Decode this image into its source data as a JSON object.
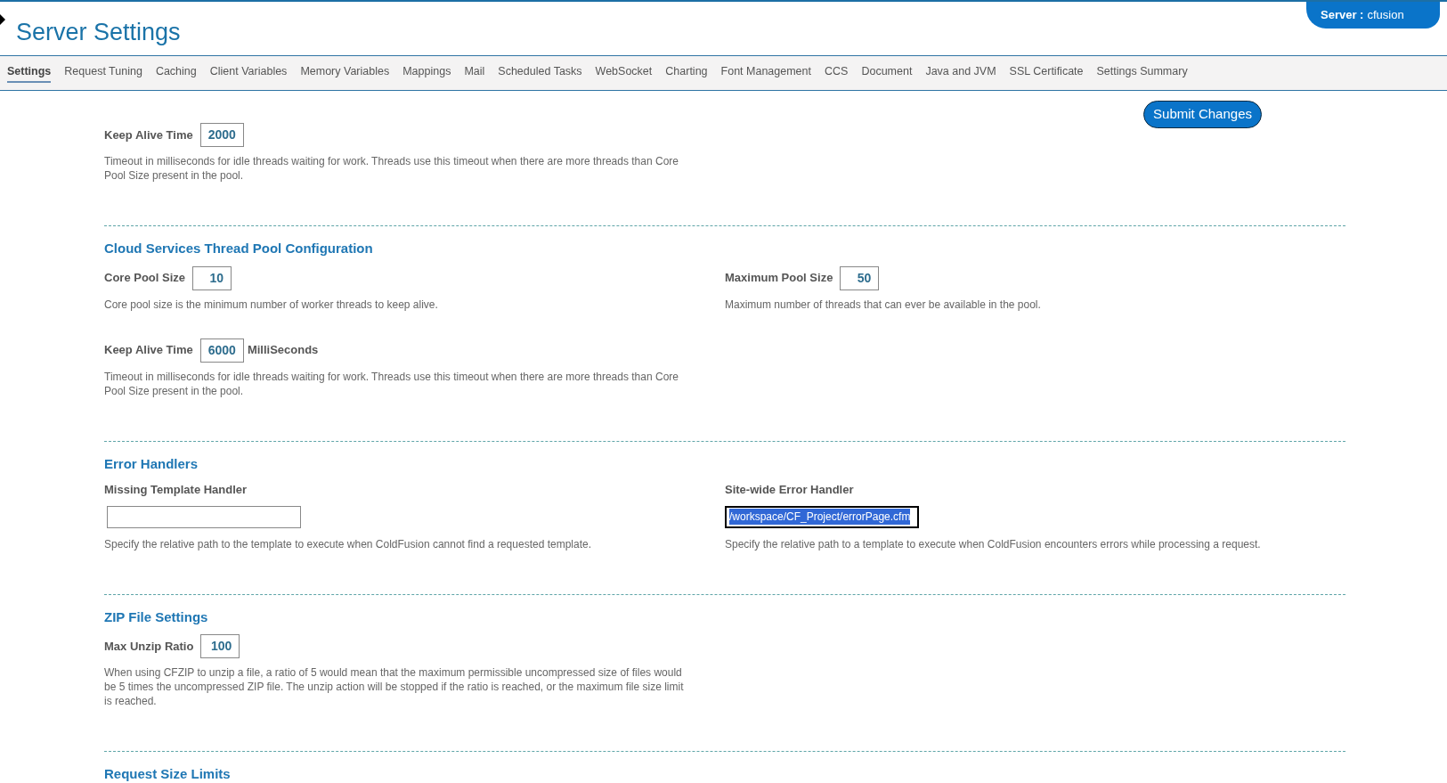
{
  "header": {
    "title": "Server Settings",
    "server_label": "Server :",
    "server_name": "cfusion"
  },
  "tabs": [
    {
      "label": "Settings",
      "selected": true
    },
    {
      "label": "Request Tuning",
      "selected": false
    },
    {
      "label": "Caching",
      "selected": false
    },
    {
      "label": "Client Variables",
      "selected": false
    },
    {
      "label": "Memory Variables",
      "selected": false
    },
    {
      "label": "Mappings",
      "selected": false
    },
    {
      "label": "Mail",
      "selected": false
    },
    {
      "label": "Scheduled Tasks",
      "selected": false
    },
    {
      "label": "WebSocket",
      "selected": false
    },
    {
      "label": "Charting",
      "selected": false
    },
    {
      "label": "Font Management",
      "selected": false
    },
    {
      "label": "CCS",
      "selected": false
    },
    {
      "label": "Document",
      "selected": false
    },
    {
      "label": "Java and JVM",
      "selected": false
    },
    {
      "label": "SSL Certificate",
      "selected": false
    },
    {
      "label": "Settings Summary",
      "selected": false
    }
  ],
  "submit_button": "Submit Changes",
  "sections": [
    {
      "rows": [
        [
          {
            "kind": "inline",
            "label": "Keep Alive Time",
            "value": "2000",
            "description": "Timeout in milliseconds for idle threads waiting for work. Threads use this timeout when there are more threads than Core Pool Size present in the pool."
          }
        ]
      ]
    },
    {
      "title": "Cloud Services Thread Pool Configuration",
      "rows": [
        [
          {
            "kind": "inline",
            "label": "Core Pool Size",
            "value": "10",
            "description": "Core pool size is the minimum number of worker threads to keep alive."
          },
          {
            "kind": "inline",
            "label": "Maximum Pool Size",
            "value": "50",
            "description": "Maximum number of threads that can ever be available in the pool."
          }
        ],
        [
          {
            "kind": "inline",
            "label": "Keep Alive Time",
            "value": "6000",
            "unit": "MilliSeconds",
            "description": "Timeout in milliseconds for idle threads waiting for work. Threads use this timeout when there are more threads than Core Pool Size present in the pool."
          }
        ]
      ]
    },
    {
      "title": "Error Handlers",
      "rows": [
        [
          {
            "kind": "stacked",
            "label": "Missing Template Handler",
            "value_selected": false,
            "description": "Specify the relative path to the template to execute when ColdFusion cannot find a requested template."
          },
          {
            "kind": "stacked",
            "label": "Site-wide Error Handler",
            "value": "/workspace/CF_Project/errorPage.cfm",
            "value_selected": true,
            "description": "Specify the relative path to a template to execute when ColdFusion encounters errors while processing a request."
          }
        ]
      ]
    },
    {
      "title": "ZIP File Settings",
      "rows": [
        [
          {
            "kind": "inline",
            "label": "Max Unzip Ratio",
            "value": "100",
            "description": "When using CFZIP to unzip a file, a ratio of 5 would mean that the maximum permissible uncompressed size of files would be 5 times the uncompressed ZIP file. The unzip action will be stopped if the ratio is reached, or the maximum file size limit is reached."
          }
        ]
      ]
    },
    {
      "title": "Request Size Limits"
    }
  ]
}
